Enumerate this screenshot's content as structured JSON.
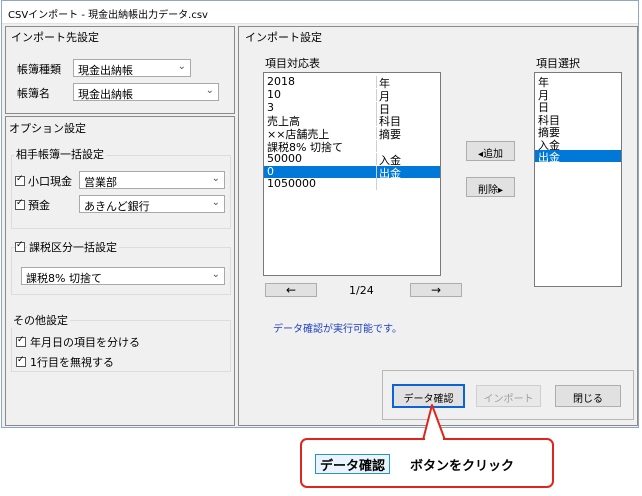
{
  "window": {
    "title": "CSVインポート - 現金出納帳出力データ.csv"
  },
  "import_target": {
    "title": "インポート先設定",
    "book_type_label": "帳簿種類",
    "book_type_value": "現金出納帳",
    "book_name_label": "帳簿名",
    "book_name_value": "現金出納帳"
  },
  "options": {
    "title": "オプション設定",
    "counter_group": {
      "title": "相手帳簿一括設定",
      "petty_cash_label": "小口現金",
      "petty_cash_value": "営業部",
      "deposit_label": "預金",
      "deposit_value": "あきんど銀行"
    },
    "tax_group": {
      "title": "課税区分一括設定",
      "value": "課税8% 切捨て"
    },
    "other_group": {
      "title": "その他設定",
      "split_date_label": "年月日の項目を分ける",
      "skip_first_label": "1行目を無視する"
    }
  },
  "import_settings": {
    "title": "インポート設定",
    "mapping_title": "項目対応表",
    "mapping_rows": [
      {
        "value": "2018",
        "field": "年"
      },
      {
        "value": "10",
        "field": "月"
      },
      {
        "value": "3",
        "field": "日"
      },
      {
        "value": "売上高",
        "field": "科目"
      },
      {
        "value": "××店舗売上",
        "field": "摘要"
      },
      {
        "value": "課税8% 切捨て",
        "field": ""
      },
      {
        "value": "50000",
        "field": "入金"
      },
      {
        "value": "0",
        "field": "出金"
      },
      {
        "value": "1050000",
        "field": ""
      }
    ],
    "selected_row": 7,
    "item_select_title": "項目選択",
    "item_options": [
      "年",
      "月",
      "日",
      "科目",
      "摘要",
      "入金",
      "出金"
    ],
    "selected_item": 6,
    "add_button": "◂追加",
    "remove_button": "削除▸",
    "prev_arrow": "←",
    "next_arrow": "→",
    "page_indicator": "1/24",
    "status_message": "データ確認が実行可能です。",
    "check_button": "データ確認",
    "import_button": "インポート",
    "close_button": "閉じる"
  },
  "callout": {
    "highlight": "データ確認",
    "text": "ボタンをクリック"
  },
  "colors": {
    "selection": "#0078d7",
    "callout_border": "#e0261b",
    "status_text": "#1f3fbf",
    "focus_highlight": "#0a64d6"
  }
}
